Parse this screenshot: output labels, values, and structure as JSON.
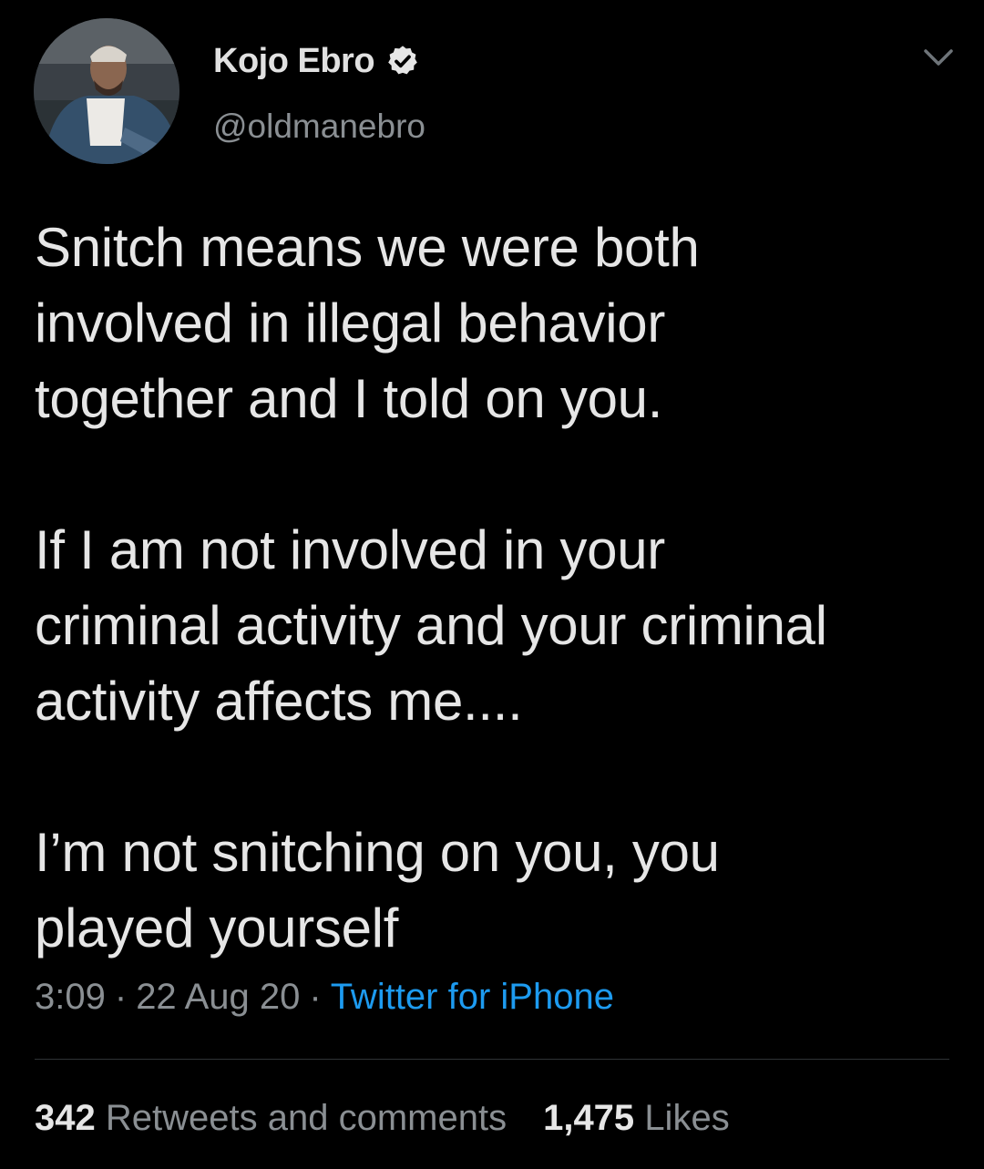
{
  "tweet": {
    "author": {
      "display_name": "Kojo Ebro",
      "handle": "@oldmanebro",
      "verified": true,
      "verified_icon": "verified-badge-icon",
      "avatar_icon": "profile-photo"
    },
    "menu_icon": "chevron-down-icon",
    "text": {
      "paragraph_1": [
        "Snitch means we were both",
        "involved in illegal behavior",
        "together and I told on you."
      ],
      "paragraph_2": [
        "If I am not involved in your",
        "criminal activity and your criminal",
        "activity affects me...."
      ],
      "paragraph_3": [
        "I’m not snitching on you, you",
        "played yourself"
      ]
    },
    "meta": {
      "time": "3:09",
      "separator": "·",
      "date": "22 Aug 20",
      "source": "Twitter for iPhone"
    },
    "stats": {
      "retweets_count": "342",
      "retweets_label": "Retweets and comments",
      "likes_count": "1,475",
      "likes_label": "Likes"
    }
  },
  "colors": {
    "background": "#000000",
    "text_primary": "#e6e6e6",
    "text_secondary": "#8a8f93",
    "link": "#1d9bf0",
    "divider": "#2f3336"
  }
}
